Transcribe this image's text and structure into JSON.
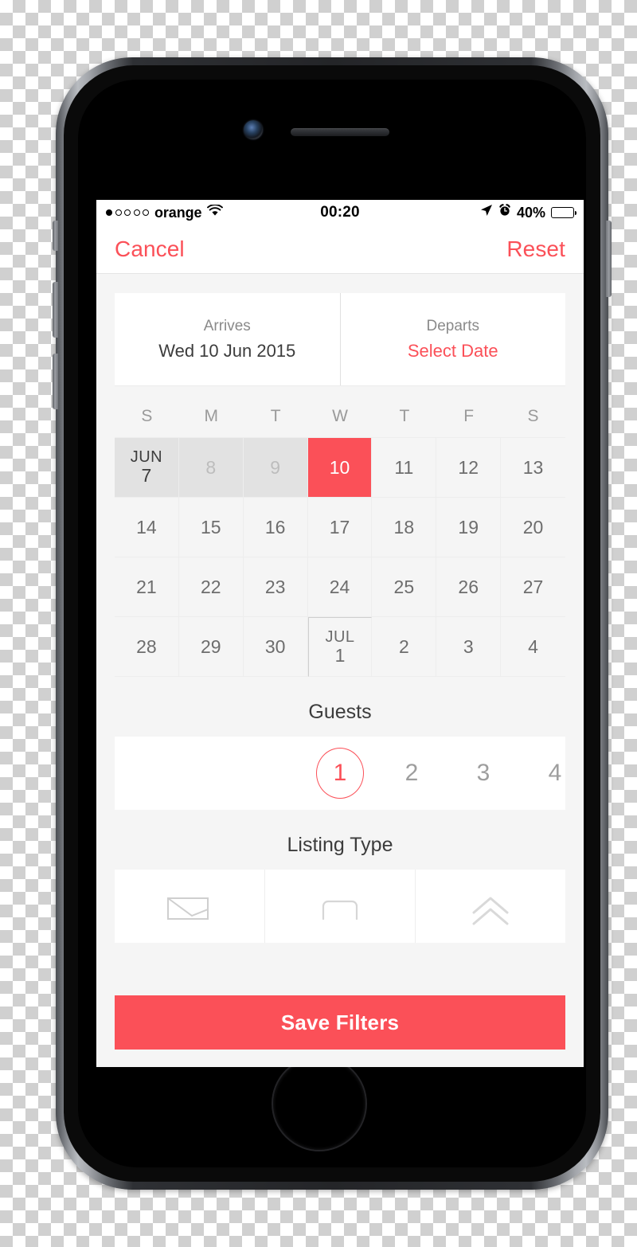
{
  "status_bar": {
    "carrier": "orange",
    "signal_dots_total": 5,
    "signal_dots_filled": 1,
    "wifi_icon": "wifi-icon",
    "time": "00:20",
    "location_icon": "location-arrow-icon",
    "alarm_icon": "alarm-clock-icon",
    "battery_percent": "40%",
    "battery_level": 40
  },
  "nav": {
    "cancel_label": "Cancel",
    "reset_label": "Reset"
  },
  "date_summary": {
    "arrives_label": "Arrives",
    "arrives_value": "Wed 10 Jun 2015",
    "departs_label": "Departs",
    "departs_value": "Select Date"
  },
  "calendar": {
    "weekdays": [
      "S",
      "M",
      "T",
      "W",
      "T",
      "F",
      "S"
    ],
    "rows": [
      [
        {
          "month": "JUN",
          "day": "7",
          "state": "today-start"
        },
        {
          "day": "8",
          "state": "past"
        },
        {
          "day": "9",
          "state": "past"
        },
        {
          "day": "10",
          "state": "sel"
        },
        {
          "day": "11",
          "state": "normal"
        },
        {
          "day": "12",
          "state": "normal"
        },
        {
          "day": "13",
          "state": "normal"
        }
      ],
      [
        {
          "day": "14",
          "state": "normal"
        },
        {
          "day": "15",
          "state": "normal"
        },
        {
          "day": "16",
          "state": "normal"
        },
        {
          "day": "17",
          "state": "normal"
        },
        {
          "day": "18",
          "state": "normal"
        },
        {
          "day": "19",
          "state": "normal"
        },
        {
          "day": "20",
          "state": "normal"
        }
      ],
      [
        {
          "day": "21",
          "state": "normal"
        },
        {
          "day": "22",
          "state": "normal"
        },
        {
          "day": "23",
          "state": "normal"
        },
        {
          "day": "24",
          "state": "normal"
        },
        {
          "day": "25",
          "state": "normal"
        },
        {
          "day": "26",
          "state": "normal"
        },
        {
          "day": "27",
          "state": "normal"
        }
      ],
      [
        {
          "day": "28",
          "state": "normal"
        },
        {
          "day": "29",
          "state": "normal"
        },
        {
          "day": "30",
          "state": "normal"
        },
        {
          "month": "JUL",
          "day": "1",
          "state": "month-start"
        },
        {
          "day": "2",
          "state": "normal"
        },
        {
          "day": "3",
          "state": "normal"
        },
        {
          "day": "4",
          "state": "normal"
        }
      ]
    ]
  },
  "guests": {
    "title": "Guests",
    "options": [
      "1",
      "2",
      "3",
      "4"
    ],
    "selected": "1"
  },
  "listing_type": {
    "title": "Listing Type",
    "options": [
      {
        "icon": "entire-home-icon"
      },
      {
        "icon": "private-room-bed-icon"
      },
      {
        "icon": "shared-room-icon"
      }
    ]
  },
  "footer": {
    "save_label": "Save Filters"
  },
  "colors": {
    "accent": "#fb5058",
    "screen_background": "#f5f5f5",
    "card_background": "#ffffff",
    "past_day_background": "#e2e2e2",
    "text_primary": "#3c3c3c",
    "text_muted": "#9a9a9a"
  }
}
